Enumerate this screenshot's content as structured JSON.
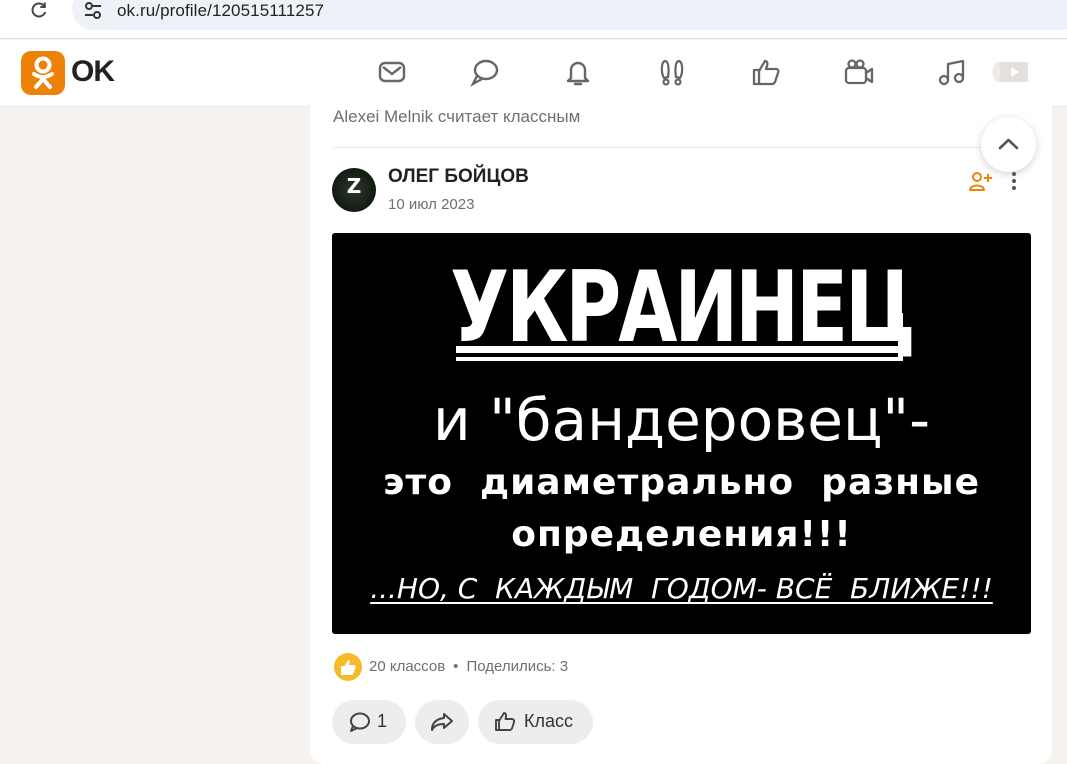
{
  "browser": {
    "url": "ok.ru/profile/120515111257"
  },
  "header": {
    "logo_text": "OK",
    "nav": [
      {
        "icon": "messages-icon"
      },
      {
        "icon": "discussions-icon"
      },
      {
        "icon": "notifications-icon"
      },
      {
        "icon": "guests-icon"
      },
      {
        "icon": "events-icon"
      },
      {
        "icon": "video-icon"
      },
      {
        "icon": "music-icon"
      },
      {
        "icon": "video-showcase-icon"
      }
    ]
  },
  "feed": {
    "activity_text": "Alexei Melnik считает классным",
    "post": {
      "author": "ОЛЕГ БОЙЦОВ",
      "date": "10 июл 2023",
      "avatar_letter": "Z",
      "image": {
        "title": "УКРАИНЕЦ",
        "line2": "и \"бандеровец\"-",
        "line3": "это  диаметрально  разные",
        "line4": "определения!!!",
        "line5": "...НО, С  КАЖДЫМ  ГОДОМ- ВСЁ  БЛИЖЕ!!!"
      },
      "likes_text": "20 классов",
      "separator": "•",
      "shares_text": "Поделились: 3",
      "comment_count": "1",
      "like_button_label": "Класс"
    }
  },
  "colors": {
    "brand": "#ee8208",
    "like_badge": "#f7b928",
    "page_background": "#f5f2ef"
  }
}
